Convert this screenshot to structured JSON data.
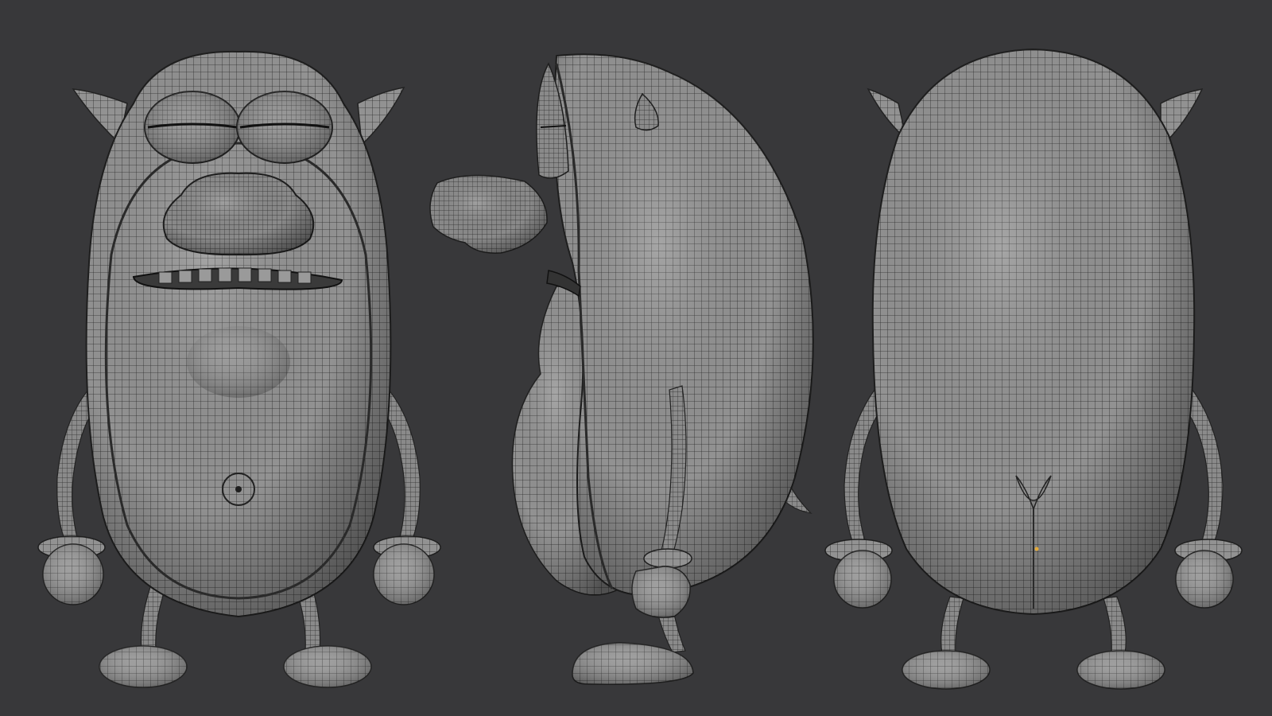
{
  "scene": {
    "background": "#38383a",
    "mesh_fill": "#8e8e8e",
    "wire_color": "#222222",
    "views": [
      {
        "name": "front",
        "features": [
          "ears",
          "eyes",
          "nose",
          "teeth",
          "navel",
          "arms",
          "hands",
          "legs",
          "feet"
        ]
      },
      {
        "name": "side",
        "features": [
          "nose",
          "eye",
          "ear",
          "belly",
          "arm",
          "hand",
          "leg",
          "foot",
          "tail"
        ]
      },
      {
        "name": "back",
        "features": [
          "ears",
          "back",
          "tail-point",
          "arms",
          "hands",
          "legs",
          "feet"
        ]
      }
    ],
    "highlight_color": "#e2a93a"
  }
}
